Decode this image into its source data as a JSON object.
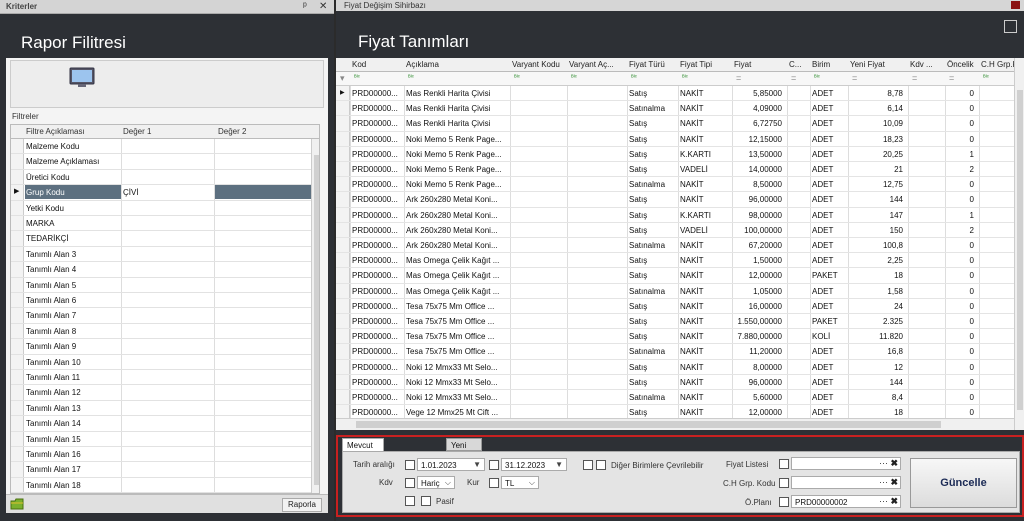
{
  "left": {
    "window_title": "Kriterler",
    "pin": "ᵖ",
    "close": "✕",
    "header": "Rapor Filitresi",
    "filters_label": "Filtreler",
    "columns": [
      "Filtre Açıklaması",
      "Değer 1",
      "Değer 2"
    ],
    "rows": [
      {
        "name": "Malzeme Kodu",
        "v1": ""
      },
      {
        "name": "Malzeme Açıklaması",
        "v1": ""
      },
      {
        "name": "Üretici Kodu",
        "v1": ""
      },
      {
        "name": "Grup Kodu",
        "v1": "ÇİVİ",
        "selected": true
      },
      {
        "name": "Yetki Kodu",
        "v1": ""
      },
      {
        "name": "MARKA",
        "v1": ""
      },
      {
        "name": "TEDARİKÇİ",
        "v1": ""
      },
      {
        "name": "Tanımlı Alan 3",
        "v1": ""
      },
      {
        "name": "Tanımlı Alan 4",
        "v1": ""
      },
      {
        "name": "Tanımlı Alan 5",
        "v1": ""
      },
      {
        "name": "Tanımlı Alan 6",
        "v1": ""
      },
      {
        "name": "Tanımlı Alan 7",
        "v1": ""
      },
      {
        "name": "Tanımlı Alan 8",
        "v1": ""
      },
      {
        "name": "Tanımlı Alan 9",
        "v1": ""
      },
      {
        "name": "Tanımlı Alan 10",
        "v1": ""
      },
      {
        "name": "Tanımlı Alan 11",
        "v1": ""
      },
      {
        "name": "Tanımlı Alan 12",
        "v1": ""
      },
      {
        "name": "Tanımlı Alan 13",
        "v1": ""
      },
      {
        "name": "Tanımlı Alan 14",
        "v1": ""
      },
      {
        "name": "Tanımlı Alan 15",
        "v1": ""
      },
      {
        "name": "Tanımlı Alan 16",
        "v1": ""
      },
      {
        "name": "Tanımlı Alan 17",
        "v1": ""
      },
      {
        "name": "Tanımlı Alan 18",
        "v1": ""
      }
    ],
    "report_button": "Raporla"
  },
  "right": {
    "window_title": "Fiyat Değişim Sihirbazı",
    "header": "Fiyat Tanımları",
    "columns": [
      "Kod",
      "Açıklama",
      "Varyant Kodu",
      "Varyant Aç...",
      "Fiyat Türü",
      "Fiyat Tipi",
      "Fiyat",
      "C...",
      "Birim",
      "Yeni Fiyat",
      "Kdv ...",
      "Öncelik",
      "C.H Grp.Ko"
    ],
    "rows": [
      [
        "PRD00000...",
        "Mas Renkli Harita Çivisi",
        "Satış",
        "NAKİT",
        "5,85000",
        "ADET",
        "8,78",
        "0"
      ],
      [
        "PRD00000...",
        "Mas Renkli Harita Çivisi",
        "Satınalma",
        "NAKİT",
        "4,09000",
        "ADET",
        "6,14",
        "0"
      ],
      [
        "PRD00000...",
        "Mas Renkli Harita Çivisi",
        "Satış",
        "NAKİT",
        "6,72750",
        "ADET",
        "10,09",
        "0"
      ],
      [
        "PRD00000...",
        "Noki Memo 5 Renk Page...",
        "Satış",
        "NAKİT",
        "12,15000",
        "ADET",
        "18,23",
        "0"
      ],
      [
        "PRD00000...",
        "Noki Memo 5 Renk Page...",
        "Satış",
        "K.KARTI",
        "13,50000",
        "ADET",
        "20,25",
        "1"
      ],
      [
        "PRD00000...",
        "Noki Memo 5 Renk Page...",
        "Satış",
        "VADELİ",
        "14,00000",
        "ADET",
        "21",
        "2"
      ],
      [
        "PRD00000...",
        "Noki Memo 5 Renk Page...",
        "Satınalma",
        "NAKİT",
        "8,50000",
        "ADET",
        "12,75",
        "0"
      ],
      [
        "PRD00000...",
        "Ark 260x280 Metal Koni...",
        "Satış",
        "NAKİT",
        "96,00000",
        "ADET",
        "144",
        "0"
      ],
      [
        "PRD00000...",
        "Ark 260x280 Metal Koni...",
        "Satış",
        "K.KARTI",
        "98,00000",
        "ADET",
        "147",
        "1"
      ],
      [
        "PRD00000...",
        "Ark 260x280 Metal Koni...",
        "Satış",
        "VADELİ",
        "100,00000",
        "ADET",
        "150",
        "2"
      ],
      [
        "PRD00000...",
        "Ark 260x280 Metal Koni...",
        "Satınalma",
        "NAKİT",
        "67,20000",
        "ADET",
        "100,8",
        "0"
      ],
      [
        "PRD00000...",
        "Mas Omega Çelik Kağıt ...",
        "Satış",
        "NAKİT",
        "1,50000",
        "ADET",
        "2,25",
        "0"
      ],
      [
        "PRD00000...",
        "Mas Omega Çelik Kağıt ...",
        "Satış",
        "NAKİT",
        "12,00000",
        "PAKET",
        "18",
        "0"
      ],
      [
        "PRD00000...",
        "Mas Omega Çelik Kağıt ...",
        "Satınalma",
        "NAKİT",
        "1,05000",
        "ADET",
        "1,58",
        "0"
      ],
      [
        "PRD00000...",
        "Tesa 75x75 Mm Office ...",
        "Satış",
        "NAKİT",
        "16,00000",
        "ADET",
        "24",
        "0"
      ],
      [
        "PRD00000...",
        "Tesa 75x75 Mm Office ...",
        "Satış",
        "NAKİT",
        "1.550,00000",
        "PAKET",
        "2.325",
        "0"
      ],
      [
        "PRD00000...",
        "Tesa 75x75 Mm Office ...",
        "Satış",
        "NAKİT",
        "7.880,00000",
        "KOLİ",
        "11.820",
        "0"
      ],
      [
        "PRD00000...",
        "Tesa 75x75 Mm Office ...",
        "Satınalma",
        "NAKİT",
        "11,20000",
        "ADET",
        "16,8",
        "0"
      ],
      [
        "PRD00000...",
        "Noki 12 Mmx33 Mt Selo...",
        "Satış",
        "NAKİT",
        "8,00000",
        "ADET",
        "12",
        "0"
      ],
      [
        "PRD00000...",
        "Noki 12 Mmx33 Mt Selo...",
        "Satış",
        "NAKİT",
        "96,00000",
        "ADET",
        "144",
        "0"
      ],
      [
        "PRD00000...",
        "Noki 12 Mmx33 Mt Selo...",
        "Satınalma",
        "NAKİT",
        "5,60000",
        "ADET",
        "8,4",
        "0"
      ],
      [
        "PRD00000...",
        "Vege 12 Mmx25 Mt Cift ...",
        "Satış",
        "NAKİT",
        "12,00000",
        "ADET",
        "18",
        "0"
      ]
    ]
  },
  "bottom": {
    "tab1": "Mevcut Fiyatları Güncelle",
    "tab2": "Yeni Fiyat Oluştur",
    "tarih_label": "Tarih aralığı",
    "date1": "1.01.2023",
    "date2": "31.12.2023",
    "diger_label": "Diğer Birimlere Çevrilebilir",
    "kdv_label": "Kdv",
    "kdv_value": "Hariç",
    "kur_label": "Kur",
    "kur_value": "TL",
    "pasif_label": "Pasif",
    "fiyat_listesi_label": "Fiyat Listesi",
    "fiyat_listesi_value": "",
    "ch_label": "C.H Grp. Kodu",
    "ch_value": "",
    "oplani_label": "Ö.Planı",
    "oplani_value": "PRD00000002",
    "dots": "···",
    "clear": "✖",
    "guncelle": "Güncelle"
  }
}
